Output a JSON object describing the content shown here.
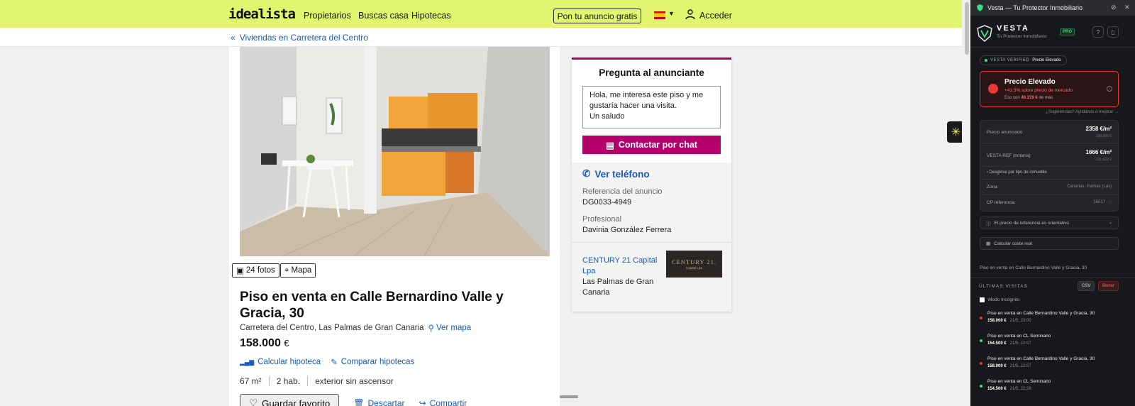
{
  "header": {
    "logo": "idealista",
    "nav": [
      "Propietarios",
      "Buscas casa",
      "Hipotecas"
    ],
    "publish_button": "Pon tu anuncio gratis",
    "login": "Acceder"
  },
  "breadcrumb": "Viviendas en Carretera del Centro",
  "listing": {
    "photos_label": "24 fotos",
    "map_label": "Mapa",
    "title": "Piso en venta en Calle Bernardino Valle y Gracia, 30",
    "address": "Carretera del Centro, Las Palmas de Gran Canaria",
    "ver_mapa": "Ver mapa",
    "price": "158.000",
    "currency": "€",
    "calc_hipoteca": "Calcular hipoteca",
    "comparar_hipotecas": "Comparar hipotecas",
    "features": [
      "67 m²",
      "2 hab.",
      "exterior sin ascensor"
    ],
    "save_fav": "Guardar favorito",
    "discard": "Descartar",
    "share": "Compartir"
  },
  "contact": {
    "title": "Pregunta al anunciante",
    "message": "Hola, me interesa este piso y me gustaría hacer una visita.\nUn saludo",
    "chat_button": "Contactar por chat",
    "phone": "Ver teléfono",
    "ref_label": "Referencia del anuncio",
    "ref_value": "DG0033-4949",
    "pro_label": "Profesional",
    "pro_value": "Davinia González Ferrera",
    "agency": "CENTURY 21 Capital Lpa",
    "agency_city": "Las Palmas de Gran Canaria",
    "agency_logo_text": "CENTURY 21.",
    "agency_logo_sub": "Capital Lpa"
  },
  "extension": {
    "window_title": "Vesta — Tu Protector Inmobiliario",
    "brand": "VESTA",
    "tagline": "Tu Protector Inmobiliario",
    "pro": "PRO",
    "verified_label": "VESTA VERIFIED",
    "verified_value": "Precio Elevado",
    "alert_title": "Precio Elevado",
    "alert_sub": "+41.5% sobre precio de mercado",
    "alert_extra_pre": "Eso son",
    "alert_extra_amount": "46.378 €",
    "alert_extra_post": "de más",
    "suggestions": "¿Sugerencias? Ayúdanos a mejorar →",
    "precio_anunciado_label": "Precio anunciado",
    "precio_anunciado_value": "2358 €/m²",
    "precio_anunciado_sub": "158.000 €",
    "ref_label": "VESTA REF (notaría)",
    "ref_value": "1666 €/m²",
    "ref_sub": "~111.622 €",
    "desglose": "Desglose por tipo de inmueble",
    "zona_label": "Zona",
    "zona_value": "Canarias, Palmas (Las)",
    "cp_label": "CP referencia",
    "cp_value": "35017",
    "ref_note": "El precio de referencia es orientativo",
    "calc_coste": "Calcular coste real",
    "listing_name": "Piso en venta en Calle Bernardino Valle y Gracia, 30",
    "visits_header": "ÚLTIMAS VISITAS",
    "csv": "CSV",
    "borrar": "Borrar",
    "incognito": "Modo Incógnito",
    "visits": [
      {
        "title": "Piso en venta en Calle Bernardino Valle y Gracia, 30",
        "price": "158.000 €",
        "date": "21/5, 23:00",
        "color": "#e53935"
      },
      {
        "title": "Piso en venta en CL Seminario",
        "price": "154.500 €",
        "date": "21/5, 22:57",
        "color": "#3ddc84"
      },
      {
        "title": "Piso en venta en Calle Bernardino Valle y Gracia, 30",
        "price": "158.000 €",
        "date": "21/5, 22:57",
        "color": "#e53935"
      },
      {
        "title": "Piso en venta en CL Seminario",
        "price": "154.500 €",
        "date": "21/5, 22:26",
        "color": "#3ddc84"
      }
    ]
  },
  "colors": {
    "brand_bar": "#e1f56e",
    "accent_magenta": "#b3006a",
    "link_blue": "#1a5ab8",
    "alert_red": "#e53935",
    "ok_green": "#3ddc84"
  }
}
